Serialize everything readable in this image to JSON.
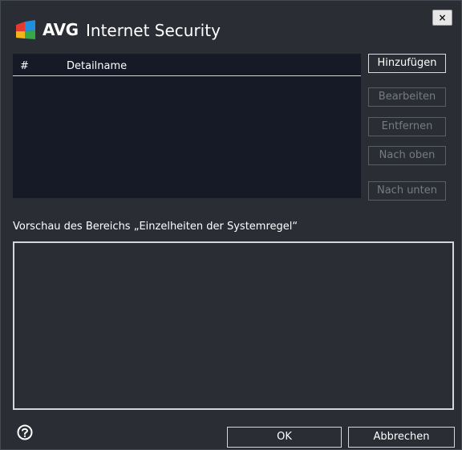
{
  "window": {
    "brand": "AVG",
    "product": "Internet Security",
    "close_label": "×"
  },
  "details_table": {
    "columns": [
      "#",
      "Detailname"
    ],
    "rows": []
  },
  "side_buttons": {
    "add": "Hinzufügen",
    "edit": "Bearbeiten",
    "remove": "Entfernen",
    "move_up": "Nach oben",
    "move_down": "Nach unten"
  },
  "preview": {
    "label": "Vorschau des Bereichs „Einzelheiten der Systemregel“",
    "content": ""
  },
  "footer": {
    "help_icon": "question-circle-icon",
    "ok": "OK",
    "cancel": "Abbrechen"
  },
  "colors": {
    "background": "#2a2d33",
    "table_background": "#161a27",
    "text": "#ffffff",
    "disabled_text": "#767b83"
  }
}
